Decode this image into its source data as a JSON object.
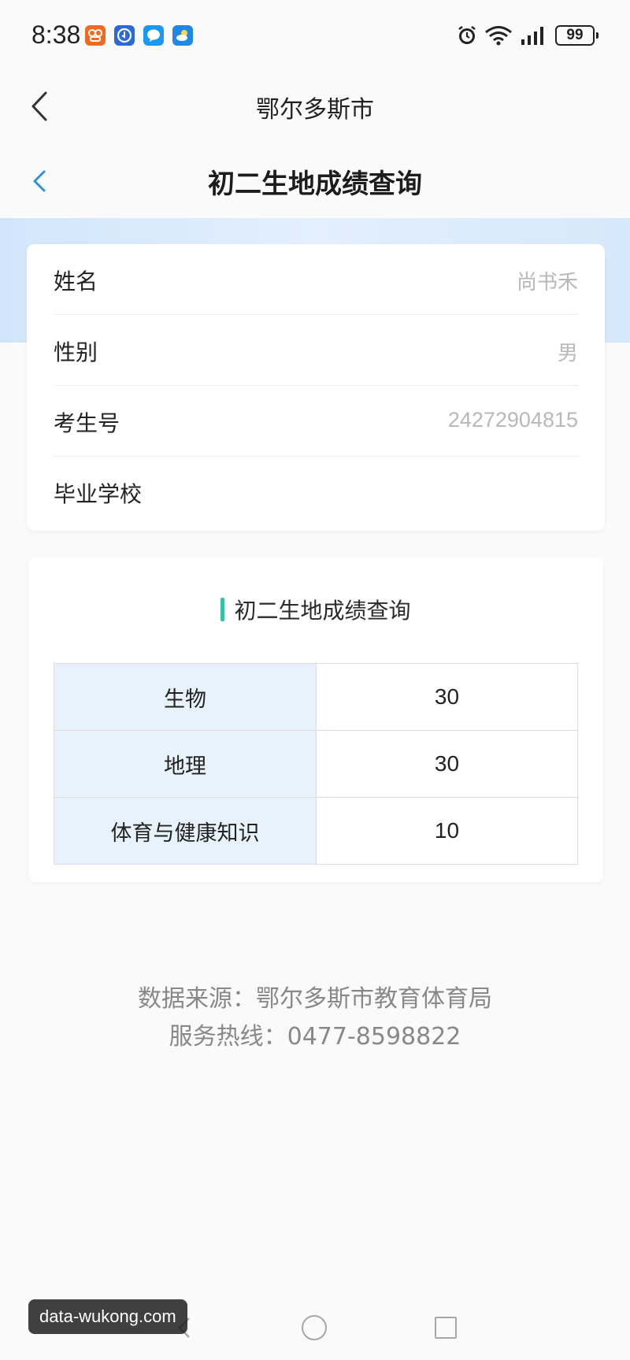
{
  "status_bar": {
    "time": "8:38",
    "battery": "99",
    "app_icons": [
      "jd-icon",
      "assist-icon",
      "chat-icon",
      "weather-icon"
    ],
    "system_icons": [
      "alarm-icon",
      "wifi-icon",
      "signal-icon",
      "battery-icon"
    ]
  },
  "outer_header": {
    "title": "鄂尔多斯市"
  },
  "inner_header": {
    "title": "初二生地成绩查询"
  },
  "info": {
    "rows": [
      {
        "label": "姓名",
        "value": "尚书禾"
      },
      {
        "label": "性别",
        "value": "男"
      },
      {
        "label": "考生号",
        "value": "24272904815"
      },
      {
        "label": "毕业学校",
        "value": ""
      }
    ]
  },
  "scores": {
    "section_title": "初二生地成绩查询",
    "rows": [
      {
        "subject": "生物",
        "score": "30"
      },
      {
        "subject": "地理",
        "score": "30"
      },
      {
        "subject": "体育与健康知识",
        "score": "10"
      }
    ]
  },
  "footer": {
    "source": "数据来源：鄂尔多斯市教育体育局",
    "hotline": "服务热线：0477-8598822"
  },
  "watermark": "data-wukong.com",
  "colors": {
    "accent_bar": "#36c2a2",
    "back_arrow_blue": "#2f8fdc",
    "subject_cell_bg": "#e8f2fd",
    "band": "#d2e6fb"
  }
}
